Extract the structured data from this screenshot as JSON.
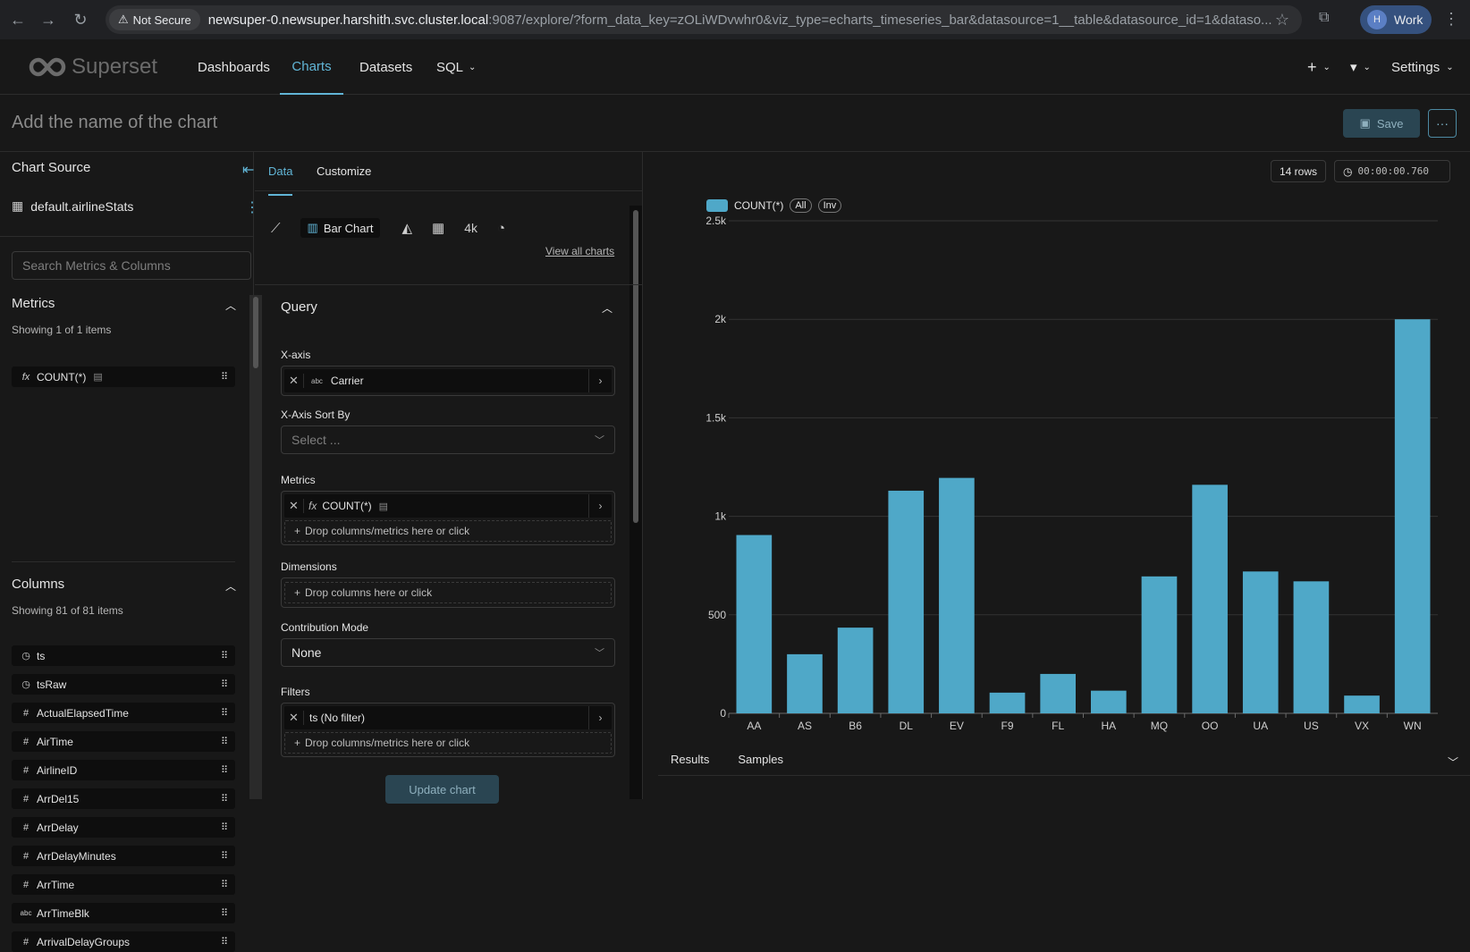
{
  "browser": {
    "security_label": "Not Secure",
    "url_host": "newsuper-0.newsuper.harshith.svc.cluster.local",
    "url_rest": ":9087/explore/?form_data_key=zOLiWDvwhr0&viz_type=echarts_timeseries_bar&datasource=1__table&datasource_id=1&dataso...",
    "profile_initial": "H",
    "profile_label": "Work"
  },
  "nav": {
    "logo_text": "Superset",
    "items": [
      "Dashboards",
      "Charts",
      "Datasets",
      "SQL"
    ],
    "active": "Charts",
    "settings_label": "Settings"
  },
  "chart_header": {
    "title_placeholder": "Add the name of the chart",
    "save_label": "Save",
    "more_label": "···"
  },
  "left_panel": {
    "title": "Chart Source",
    "datasource": "default.airlineStats",
    "search_placeholder": "Search Metrics & Columns",
    "metrics_title": "Metrics",
    "metrics_showing": "Showing 1 of 1 items",
    "metrics": [
      {
        "type": "fx",
        "name": "COUNT(*)"
      }
    ],
    "columns_title": "Columns",
    "columns_showing": "Showing 81 of 81 items",
    "columns": [
      {
        "type": "clock",
        "name": "ts"
      },
      {
        "type": "clock",
        "name": "tsRaw"
      },
      {
        "type": "#",
        "name": "ActualElapsedTime"
      },
      {
        "type": "#",
        "name": "AirTime"
      },
      {
        "type": "#",
        "name": "AirlineID"
      },
      {
        "type": "#",
        "name": "ArrDel15"
      },
      {
        "type": "#",
        "name": "ArrDelay"
      },
      {
        "type": "#",
        "name": "ArrDelayMinutes"
      },
      {
        "type": "#",
        "name": "ArrTime"
      },
      {
        "type": "abc",
        "name": "ArrTimeBlk"
      },
      {
        "type": "#",
        "name": "ArrivalDelayGroups"
      }
    ]
  },
  "mid_panel": {
    "tabs": [
      "Data",
      "Customize"
    ],
    "viz_selected": "Bar Chart",
    "viz_big_number": "4k",
    "view_all": "View all charts",
    "query_title": "Query",
    "xaxis_label": "X-axis",
    "xaxis_value": "Carrier",
    "xaxis_sort_label": "X-Axis Sort By",
    "xaxis_sort_placeholder": "Select ...",
    "metrics_label": "Metrics",
    "metrics_value": "COUNT(*)",
    "metrics_drop": "Drop columns/metrics here or click",
    "dimensions_label": "Dimensions",
    "dimensions_drop": "Drop columns here or click",
    "contribution_label": "Contribution Mode",
    "contribution_value": "None",
    "filters_label": "Filters",
    "filters_value": "ts (No filter)",
    "filters_drop": "Drop columns/metrics here or click",
    "update_label": "Update chart"
  },
  "chart_panel": {
    "rows_badge": "14 rows",
    "timer": "00:00:00.760",
    "legend_label": "COUNT(*)",
    "legend_all": "All",
    "legend_inv": "Inv",
    "result_tabs": [
      "Results",
      "Samples"
    ]
  },
  "chart_data": {
    "type": "bar",
    "categories": [
      "AA",
      "AS",
      "B6",
      "DL",
      "EV",
      "F9",
      "FL",
      "HA",
      "MQ",
      "OO",
      "UA",
      "US",
      "VX",
      "WN"
    ],
    "series": [
      {
        "name": "COUNT(*)",
        "values": [
          905,
          300,
          435,
          1130,
          1195,
          105,
          200,
          115,
          695,
          1160,
          720,
          670,
          90,
          2000
        ]
      }
    ],
    "ylim": [
      0,
      2500
    ],
    "yticks": [
      0,
      500,
      1000,
      1500,
      2000,
      2500
    ],
    "ytick_labels": [
      "0",
      "500",
      "1k",
      "1.5k",
      "2k",
      "2.5k"
    ],
    "bar_color": "#4fa8c8",
    "grid": true,
    "legend": "top-left"
  }
}
